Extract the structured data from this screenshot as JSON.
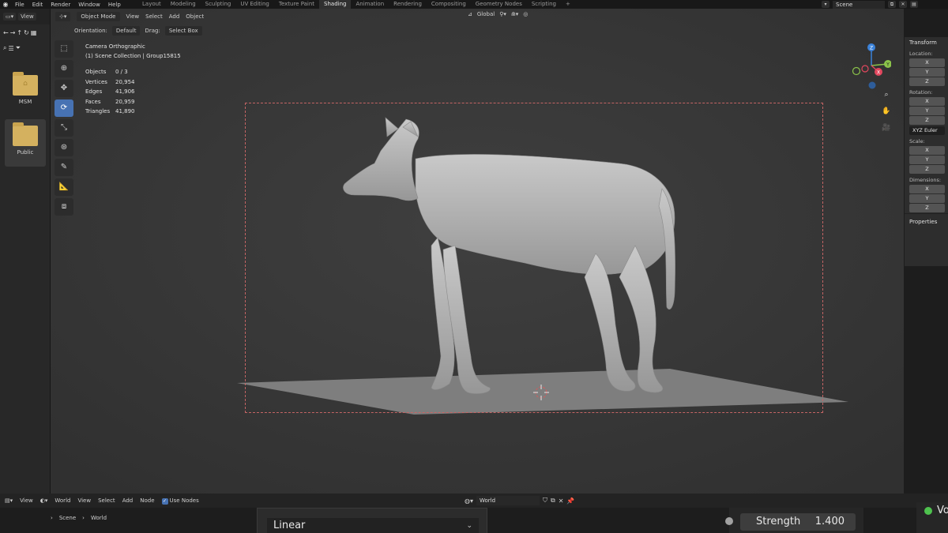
{
  "menubar": {
    "items": [
      "File",
      "Edit",
      "Render",
      "Window",
      "Help"
    ],
    "workspaces": [
      "Layout",
      "Modeling",
      "Sculpting",
      "UV Editing",
      "Texture Paint",
      "Shading",
      "Animation",
      "Rendering",
      "Compositing",
      "Geometry Nodes",
      "Scripting"
    ],
    "active_workspace": "Shading",
    "add_workspace": "+",
    "scene": "Scene"
  },
  "file_browser": {
    "view_label": "View",
    "folders": [
      {
        "label": "MSM"
      },
      {
        "label": "Public"
      }
    ]
  },
  "viewport": {
    "mode": "Object Mode",
    "menus": [
      "View",
      "Select",
      "Add",
      "Object"
    ],
    "orientation_label": "Orientation:",
    "orientation_value": "Default",
    "drag_label": "Drag:",
    "drag_value": "Select Box",
    "transform_orientation": "Global",
    "camera_label": "Camera Orthographic",
    "collection_label": "(1) Scene Collection | Group15815",
    "stats": [
      {
        "key": "Objects",
        "value": "0 / 3"
      },
      {
        "key": "Vertices",
        "value": "20,954"
      },
      {
        "key": "Edges",
        "value": "41,906"
      },
      {
        "key": "Faces",
        "value": "20,959"
      },
      {
        "key": "Triangles",
        "value": "41,890"
      }
    ],
    "gizmo_axes": {
      "x": "X",
      "y": "Y",
      "z": "Z"
    },
    "colors": {
      "x": "#e2475e",
      "y": "#8bc34a",
      "z": "#3b82d9",
      "accent": "#4772b3"
    }
  },
  "npanel": {
    "title": "Transform",
    "location_label": "Location:",
    "rotation_label": "Rotation:",
    "rotation_mode": "XYZ Euler",
    "scale_label": "Scale:",
    "dimensions_label": "Dimensions:",
    "axes": [
      "X",
      "Y",
      "Z"
    ],
    "properties_label": "Properties"
  },
  "node_editor": {
    "view_label": "View",
    "world_type": "World",
    "menus": [
      "View",
      "Select",
      "Add",
      "Node"
    ],
    "use_nodes_label": "Use Nodes",
    "world_name": "World",
    "breadcrumb": [
      "Scene",
      "World"
    ],
    "interpolation": "Linear",
    "strength_label": "Strength",
    "strength_value": "1.400",
    "output_label": "Vo"
  }
}
